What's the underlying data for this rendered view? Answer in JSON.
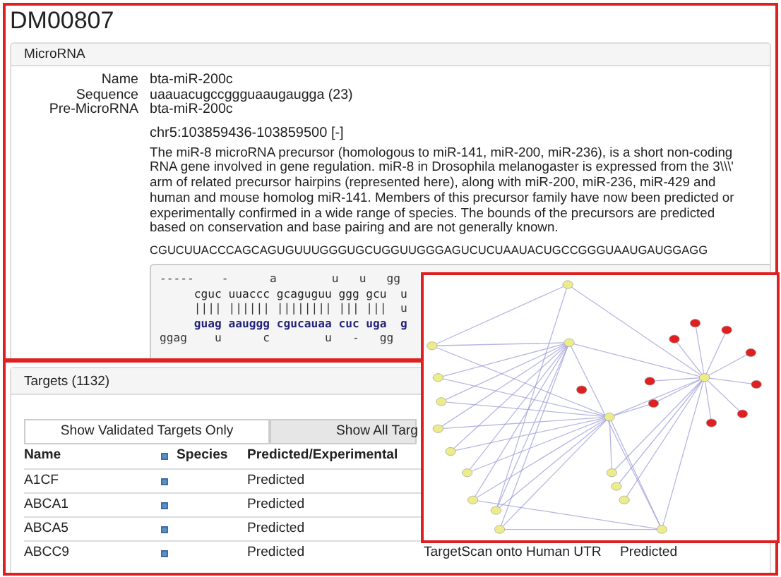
{
  "title": "DM00807",
  "microrna": {
    "header": "MicroRNA",
    "fields": [
      {
        "label": "Name",
        "value": "bta-miR-200c"
      },
      {
        "label": "Sequence",
        "value": "uaauacugccggguaaugaugga (23)"
      },
      {
        "label": "Pre-MicroRNA",
        "value": "bta-miR-200c"
      }
    ],
    "location": "chr5:103859436-103859500 [-]",
    "description": "The miR-8 microRNA precursor (homologous to miR-141, miR-200, miR-236), is a short non-coding RNA gene involved in gene regulation. miR-8 in Drosophila melanogaster is expressed from the 3\\\\\\' arm of related precursor hairpins (represented here), along with miR-200, miR-236, miR-429 and human and mouse homolog miR-141. Members of this precursor family have now been predicted or experimentally confirmed in a wide range of species. The bounds of the precursors are predicted based on conservation and base pairing and are not generally known.",
    "precursor_sequence": "CGUCUUACCCAGCAGUGUUUGGGUGCUGGUUGGGAGUCUCUAAUACUGCCGGGUAAUGAUGGAGG",
    "hairpin": [
      {
        "kind": "unpaired",
        "text": "-----    -      a        u   u   gg"
      },
      {
        "kind": "strand",
        "text": "     cguc uuaccc gcaguguu ggg gcu  u"
      },
      {
        "kind": "pairs",
        "text": "     |||| |||||| |||||||| ||| |||  u"
      },
      {
        "kind": "complement",
        "text": "     guag aauggg cgucauaa cuc uga  g"
      },
      {
        "kind": "unpaired",
        "text": "ggag    u      c        u   -   gg"
      }
    ]
  },
  "targets": {
    "header": "Targets (1132)",
    "buttons": [
      {
        "label": "Show Validated Targets Only",
        "selected": false
      },
      {
        "label": "Show All Targ",
        "selected": true
      }
    ],
    "columns": [
      {
        "label": "Name"
      },
      {
        "label": "Species"
      },
      {
        "label": "Predicted/Experimental"
      }
    ],
    "rows": [
      {
        "name": "A1CF",
        "predicted": "Predicted"
      },
      {
        "name": "ABCA1",
        "predicted": "Predicted"
      },
      {
        "name": "ABCA5",
        "predicted": "Predicted"
      },
      {
        "name": "ABCC9",
        "predicted": "Predicted",
        "column_4": "TargetScan onto Human UTR",
        "column_5": "Predicted"
      }
    ]
  }
}
